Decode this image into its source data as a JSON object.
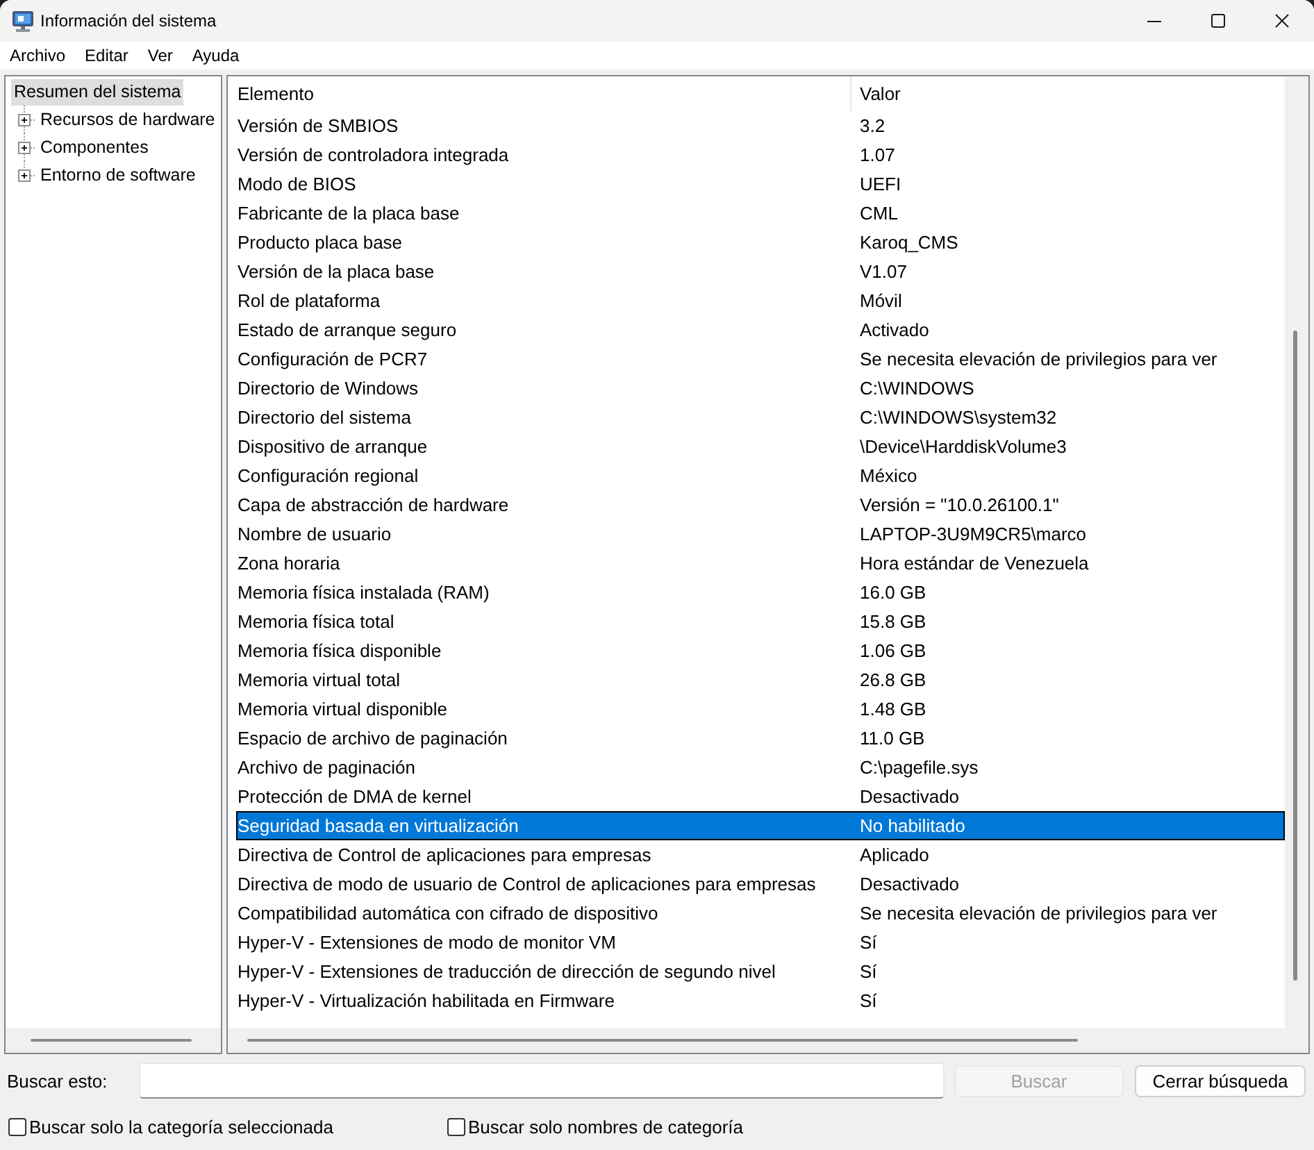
{
  "window": {
    "title": "Información del sistema"
  },
  "menu": [
    {
      "label": "Archivo"
    },
    {
      "label": "Editar"
    },
    {
      "label": "Ver"
    },
    {
      "label": "Ayuda"
    }
  ],
  "tree": [
    {
      "label": "Resumen del sistema",
      "selected": true,
      "children": [
        {
          "label": "Recursos de hardware",
          "selected": false,
          "expanded": false
        },
        {
          "label": "Componentes",
          "selected": false,
          "expanded": false
        },
        {
          "label": "Entorno de software",
          "selected": false,
          "expanded": false
        }
      ]
    }
  ],
  "table": {
    "columns": [
      "Elemento",
      "Valor"
    ],
    "rows": [
      {
        "cells": [
          "Versión de SMBIOS",
          "3.2"
        ],
        "selected": false
      },
      {
        "cells": [
          "Versión de controladora integrada",
          "1.07"
        ],
        "selected": false
      },
      {
        "cells": [
          "Modo de BIOS",
          "UEFI"
        ],
        "selected": false
      },
      {
        "cells": [
          "Fabricante de la placa base",
          "CML"
        ],
        "selected": false
      },
      {
        "cells": [
          "Producto placa base",
          "Karoq_CMS"
        ],
        "selected": false
      },
      {
        "cells": [
          "Versión de la placa base",
          "V1.07"
        ],
        "selected": false
      },
      {
        "cells": [
          "Rol de plataforma",
          "Móvil"
        ],
        "selected": false
      },
      {
        "cells": [
          "Estado de arranque seguro",
          "Activado"
        ],
        "selected": false
      },
      {
        "cells": [
          "Configuración de PCR7",
          "Se necesita elevación de privilegios para ver"
        ],
        "selected": false
      },
      {
        "cells": [
          "Directorio de Windows",
          "C:\\WINDOWS"
        ],
        "selected": false
      },
      {
        "cells": [
          "Directorio del sistema",
          "C:\\WINDOWS\\system32"
        ],
        "selected": false
      },
      {
        "cells": [
          "Dispositivo de arranque",
          "\\Device\\HarddiskVolume3"
        ],
        "selected": false
      },
      {
        "cells": [
          "Configuración regional",
          "México"
        ],
        "selected": false
      },
      {
        "cells": [
          "Capa de abstracción de hardware",
          "Versión = \"10.0.26100.1\""
        ],
        "selected": false
      },
      {
        "cells": [
          "Nombre de usuario",
          "LAPTOP-3U9M9CR5\\marco"
        ],
        "selected": false
      },
      {
        "cells": [
          "Zona horaria",
          "Hora estándar de Venezuela"
        ],
        "selected": false
      },
      {
        "cells": [
          "Memoria física instalada (RAM)",
          "16.0 GB"
        ],
        "selected": false
      },
      {
        "cells": [
          "Memoria física total",
          "15.8 GB"
        ],
        "selected": false
      },
      {
        "cells": [
          "Memoria física disponible",
          "1.06 GB"
        ],
        "selected": false
      },
      {
        "cells": [
          "Memoria virtual total",
          "26.8 GB"
        ],
        "selected": false
      },
      {
        "cells": [
          "Memoria virtual disponible",
          "1.48 GB"
        ],
        "selected": false
      },
      {
        "cells": [
          "Espacio de archivo de paginación",
          "11.0 GB"
        ],
        "selected": false
      },
      {
        "cells": [
          "Archivo de paginación",
          "C:\\pagefile.sys"
        ],
        "selected": false
      },
      {
        "cells": [
          "Protección de DMA de kernel",
          "Desactivado"
        ],
        "selected": false
      },
      {
        "cells": [
          "Seguridad basada en virtualización",
          "No habilitado"
        ],
        "selected": true
      },
      {
        "cells": [
          "Directiva de Control de aplicaciones para empresas",
          "Aplicado"
        ],
        "selected": false
      },
      {
        "cells": [
          "Directiva de modo de usuario de Control de aplicaciones para empresas",
          "Desactivado"
        ],
        "selected": false
      },
      {
        "cells": [
          "Compatibilidad automática con cifrado de dispositivo",
          "Se necesita elevación de privilegios para ver"
        ],
        "selected": false
      },
      {
        "cells": [
          "Hyper-V - Extensiones de modo de monitor VM",
          "Sí"
        ],
        "selected": false
      },
      {
        "cells": [
          "Hyper-V - Extensiones de traducción de dirección de segundo nivel",
          "Sí"
        ],
        "selected": false
      },
      {
        "cells": [
          "Hyper-V - Virtualización habilitada en Firmware",
          "Sí"
        ],
        "selected": false
      }
    ]
  },
  "search": {
    "label": "Buscar esto:",
    "buttons": [
      {
        "label": "Buscar",
        "disabled": true
      },
      {
        "label": "Cerrar búsqueda",
        "disabled": false
      }
    ],
    "options": [
      {
        "label": "Buscar solo la categoría seleccionada",
        "checked": false
      },
      {
        "label": "Buscar solo nombres de categoría",
        "checked": false
      }
    ]
  }
}
